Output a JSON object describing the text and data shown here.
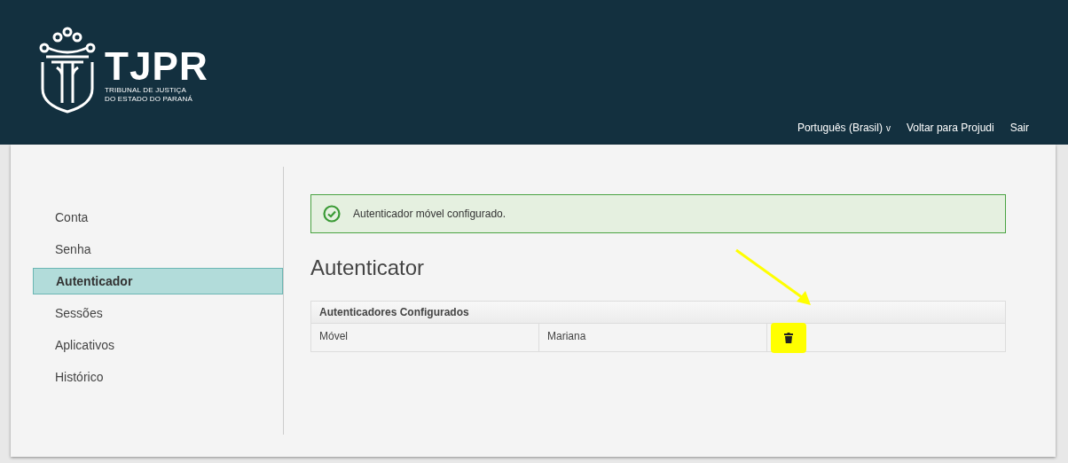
{
  "header": {
    "logo": {
      "title": "TJPR",
      "subtitle": [
        "TRIBUNAL DE JUSTIÇA",
        "DO ESTADO DO PARANÁ"
      ]
    },
    "links": [
      {
        "label": "Português (Brasil)",
        "caret": "v"
      },
      {
        "label": "Voltar para Projudi"
      },
      {
        "label": "Sair"
      }
    ]
  },
  "sidebar": {
    "items": [
      {
        "label": "Conta",
        "selected": false
      },
      {
        "label": "Senha",
        "selected": false
      },
      {
        "label": "Autenticador",
        "selected": true
      },
      {
        "label": "Sessões",
        "selected": false
      },
      {
        "label": "Aplicativos",
        "selected": false
      },
      {
        "label": "Histórico",
        "selected": false
      }
    ]
  },
  "alert": {
    "kind": "success",
    "message": "Autenticador móvel configurado."
  },
  "heading": "Autenticator",
  "table": {
    "title": "Autenticadores Configurados",
    "rows": [
      {
        "cells": [
          "Móvel",
          "Mariana"
        ],
        "highlighted": true
      }
    ]
  }
}
